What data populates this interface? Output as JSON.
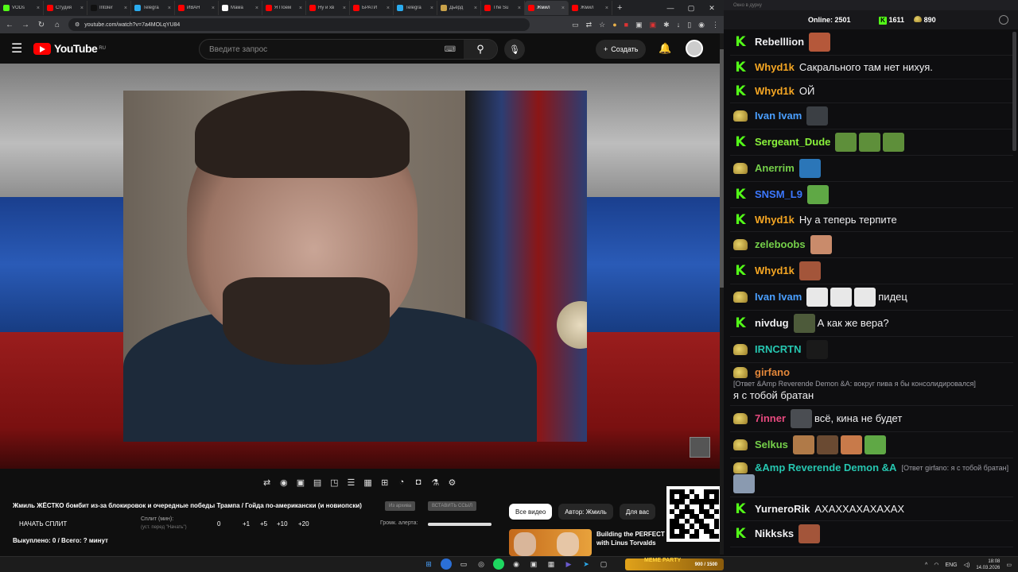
{
  "browser": {
    "tabs": [
      {
        "label": "VODs",
        "color": "#53fc18"
      },
      {
        "label": "Студия",
        "color": "#ff0000"
      },
      {
        "label": "Intoler",
        "color": "#111111"
      },
      {
        "label": "Telegra",
        "color": "#2aabee"
      },
      {
        "label": "ИВАН",
        "color": "#ff0000"
      },
      {
        "label": "Мама",
        "color": "#ffffff"
      },
      {
        "label": "Я Поем",
        "color": "#ff0000"
      },
      {
        "label": "Ну и хв",
        "color": "#ff0000"
      },
      {
        "label": "БРАТИ",
        "color": "#ff0000"
      },
      {
        "label": "Telegra",
        "color": "#2aabee"
      },
      {
        "label": "Дьёрд",
        "color": "#c9a24a"
      },
      {
        "label": "The Su",
        "color": "#ff0000"
      },
      {
        "label": "Жмил",
        "color": "#ff0000",
        "active": true
      },
      {
        "label": "Жмил",
        "color": "#ff0000"
      }
    ],
    "url": "youtube.com/watch?v=7a4MOLqYU84"
  },
  "youtube": {
    "logo_text": "YouTube",
    "region": "RU",
    "search_placeholder": "Введите запрос",
    "create_label": "Создать"
  },
  "video": {
    "title": "Жмиль ЖЁСТКО бомбит из-за блокировок и очередные победы Трампа / Гойда по-американски (и новиопски)",
    "pill_left": "Из архива",
    "pill_right": "ВСТАВИТЬ ССЫЛ",
    "split_button": "НАЧАТЬ СПЛИТ",
    "split_label": "Сплит (мин):",
    "split_sub": "(уст. перед \"Начать\")",
    "split_values": [
      "0",
      "+1",
      "+5",
      "+10",
      "+20"
    ],
    "alert_label": "Громк. алерта:",
    "alert_volume": 1.0,
    "pulled": "Выкуплено: 0 / Всего: ? минут"
  },
  "recommend": {
    "chips": [
      "Все видео",
      "Автор: Жмиль",
      "Для вас"
    ],
    "rec_title": "Building the PERFECT with Linus Torvalds"
  },
  "chat": {
    "window_title": "Окно в дурку",
    "online_label": "Online:",
    "online_count": "2501",
    "followers": "1611",
    "subs": "890",
    "messages": [
      {
        "badge": "k",
        "name": "Rebelllion",
        "color": "#efeff1",
        "text": "",
        "emotes": [
          "#b5583a"
        ]
      },
      {
        "badge": "k",
        "name": "Whyd1k",
        "color": "#f5a623",
        "text": "Сакрального там нет нихуя.",
        "emotes": []
      },
      {
        "badge": "k",
        "name": "Whyd1k",
        "color": "#f5a623",
        "text": "ОЙ",
        "emotes": []
      },
      {
        "badge": "d",
        "name": "Ivan Ivam",
        "color": "#4a9fff",
        "text": "",
        "emotes": [
          "#3b3f44"
        ]
      },
      {
        "badge": "k",
        "name": "Sergeant_Dude",
        "color": "#8af33b",
        "text": "",
        "emotes": [
          "#5e8f3a",
          "#5e8f3a",
          "#5e8f3a"
        ]
      },
      {
        "badge": "d",
        "name": "Anerrim",
        "color": "#75d04a",
        "text": "",
        "emotes": [
          "#2b76b8"
        ]
      },
      {
        "badge": "k",
        "name": "SNSM_L9",
        "color": "#3c78ff",
        "text": "",
        "emotes": [
          "#5fa845"
        ]
      },
      {
        "badge": "k",
        "name": "Whyd1k",
        "color": "#f5a623",
        "text": "Ну а теперь терпите",
        "emotes": []
      },
      {
        "badge": "d",
        "name": "zeleboobs",
        "color": "#75d04a",
        "text": "",
        "emotes": [
          "#c98b6b"
        ]
      },
      {
        "badge": "k",
        "name": "Whyd1k",
        "color": "#f5a623",
        "text": "",
        "emotes": [
          "#a3553a"
        ]
      },
      {
        "badge": "d",
        "name": "Ivan Ivam",
        "color": "#4a9fff",
        "text": "пидец",
        "emotes": [
          "#e8e8e8",
          "#e8e8e8",
          "#e8e8e8"
        ]
      },
      {
        "badge": "k",
        "name": "nivdug",
        "color": "#efeff1",
        "text": "А как же вера?",
        "emotes": [
          "#4d5a3a"
        ]
      },
      {
        "badge": "d",
        "name": "IRNCRTN",
        "color": "#26c6b0",
        "text": "",
        "emotes": [
          "#1a1a1a"
        ]
      },
      {
        "badge": "d",
        "name": "girfano",
        "color": "#e3873a",
        "reply": "[Ответ &Amp Reverende Demon &A: вокруг пива я бы консолидировался]",
        "text": "я с тобой братан",
        "emotes": []
      },
      {
        "badge": "d",
        "name": "7inner",
        "color": "#e84a7f",
        "text": "всё, кина не будет",
        "emotes": [
          "#4a4d52"
        ]
      },
      {
        "badge": "d",
        "name": "Selkus",
        "color": "#75d04a",
        "text": "",
        "emotes": [
          "#b07a48",
          "#6a4a32",
          "#c87a4a",
          "#5fa845"
        ]
      },
      {
        "badge": "d",
        "name": "&Amp Reverende Demon &A",
        "color": "#26c6b0",
        "reply": "[Ответ girfano: я с тобой братан]",
        "text": "",
        "emotes": [
          "#8a9ab0"
        ]
      },
      {
        "badge": "k",
        "name": "YurneroRik",
        "color": "#efeff1",
        "text": "АХАХХАХАХАХАХ",
        "emotes": []
      },
      {
        "badge": "k",
        "name": "Nikksks",
        "color": "#efeff1",
        "text": "",
        "emotes": [
          "#a3553a"
        ]
      }
    ]
  },
  "taskbar": {
    "meme_label": "MEME PARTY",
    "meme_value": "900 / 1500",
    "lang": "ENG",
    "time": "18:08",
    "date": "14.03.2026"
  }
}
